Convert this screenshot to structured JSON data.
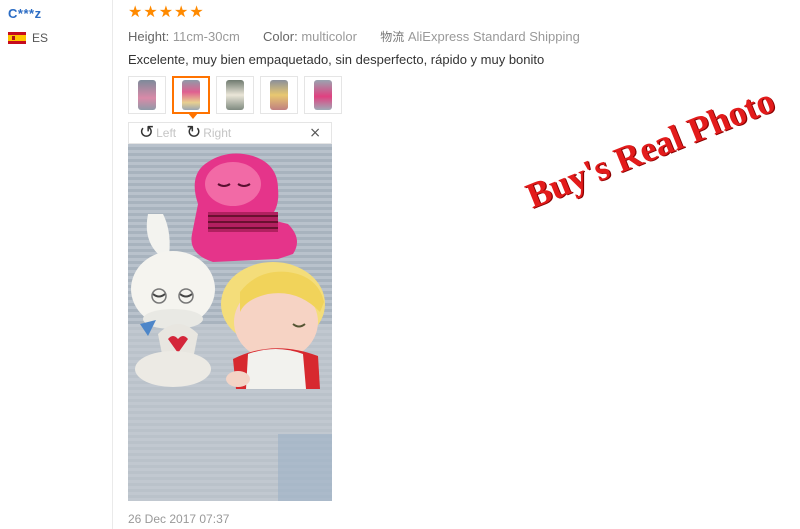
{
  "reviewer": {
    "name": "C***z",
    "country_code": "ES",
    "flag_icon": "spain-flag-icon"
  },
  "rating": {
    "stars": 5,
    "max": 5,
    "star_char": "★",
    "color": "#ff8a00"
  },
  "meta": {
    "height_label": "Height:",
    "height_value": "11cm-30cm",
    "color_label": "Color:",
    "color_value": "multicolor",
    "shipping_icon": "物流",
    "shipping_value": "AliExpress Standard Shipping"
  },
  "comment": "Excelente, muy bien empaquetado, sin desperfecto, rápido y muy bonito",
  "thumbnails": [
    {
      "index": 1,
      "active": false,
      "tone": "#d98aa8"
    },
    {
      "index": 2,
      "active": true,
      "tone": "#e06090"
    },
    {
      "index": 3,
      "active": false,
      "tone": "#9fb0a0"
    },
    {
      "index": 4,
      "active": false,
      "tone": "#d9c890"
    },
    {
      "index": 5,
      "active": false,
      "tone": "#e04080"
    }
  ],
  "viewer": {
    "rotate_left_label": "Left",
    "rotate_right_label": "Right",
    "close_symbol": "×"
  },
  "watermark": "Buy's Real Photo",
  "date": "26 Dec 2017 07:37",
  "colors": {
    "accent": "#ff7300",
    "link": "#2b6cc4",
    "watermark": "#e31b1b"
  }
}
